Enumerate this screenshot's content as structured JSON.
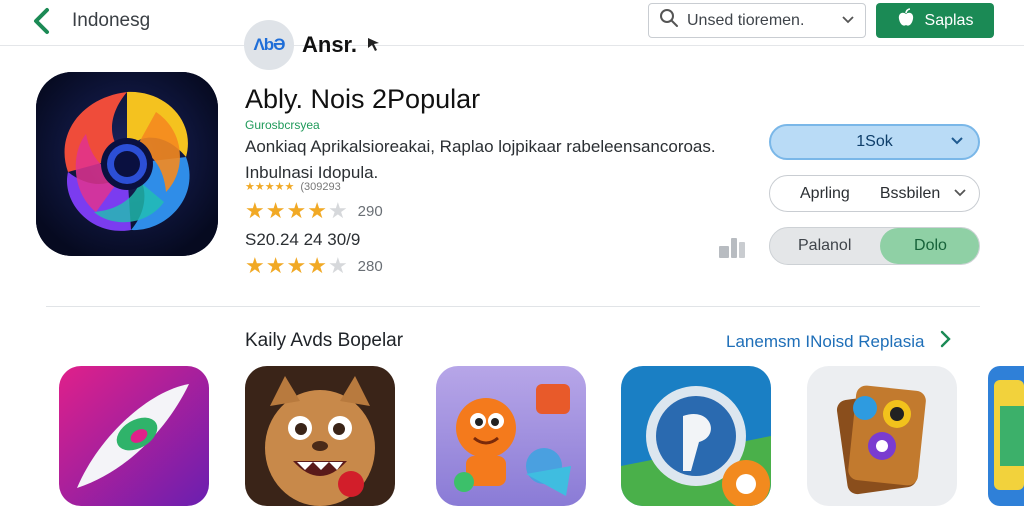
{
  "nav": {
    "back_label": "Indonesg",
    "search_placeholder": "Unsed tioremen.",
    "top_button_label": "Saplas"
  },
  "brand": {
    "logo_text": "ΛbƏ",
    "name": "Ansr."
  },
  "app": {
    "title": "Ably. Nois 2Popular",
    "developer": "Gurosbcrsyea",
    "description": "Aonkiaq Aprikalsioreakai, Raplao lojpikaar rabeleensancoroas. Inbulnasi Idopula.",
    "small_rating_text": "(309293",
    "rating_1": {
      "value": 4,
      "count": "290"
    },
    "price": "S20.24 24 30/9",
    "rating_2": {
      "value": 4,
      "count": "280"
    },
    "install_label": "1Sok",
    "select": {
      "label": "Aprling",
      "value": "Bssbilen"
    },
    "toggle": {
      "off_label": "Palanol",
      "on_label": "Dolo"
    }
  },
  "section": {
    "title": "Kaily Avds Bopelar",
    "link_label": "Lanemsm INoisd Replasia"
  },
  "icons": {
    "back": "chevron-left-icon",
    "search": "search-icon",
    "dropdown": "chevron-down-icon",
    "top_button": "apple-icon",
    "share": "share-icon",
    "link": "chevron-right-icon"
  },
  "colors": {
    "primary_green": "#1b8a55",
    "accent_blue": "#1f6fb8",
    "star": "#f1a925",
    "install_bg": "#b9dbf6",
    "toggle_on": "#8fd0a5"
  }
}
